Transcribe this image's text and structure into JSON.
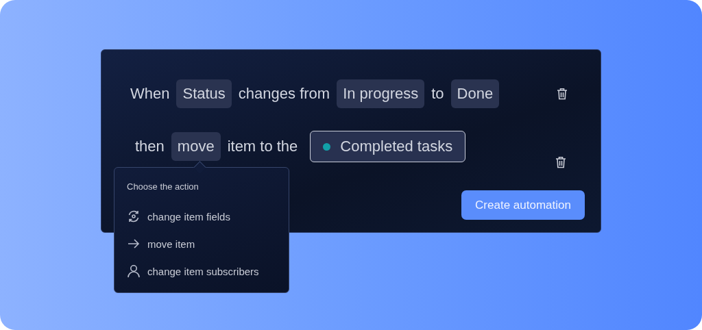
{
  "rules": [
    {
      "parts": [
        {
          "kind": "text",
          "text": "When"
        },
        {
          "kind": "chip",
          "text": "Status"
        },
        {
          "kind": "text",
          "text": "changes from"
        },
        {
          "kind": "chip",
          "text": "In progress"
        },
        {
          "kind": "text",
          "text": "to"
        },
        {
          "kind": "chip",
          "text": "Done"
        }
      ]
    },
    {
      "parts": [
        {
          "kind": "text",
          "text": "then"
        },
        {
          "kind": "chip",
          "text": "move"
        },
        {
          "kind": "text",
          "text": "item to the"
        },
        {
          "kind": "target",
          "text": "Completed tasks",
          "color": "#12a0a8"
        }
      ]
    }
  ],
  "create_button": "Create automation",
  "action_menu": {
    "title": "Choose the action",
    "items": [
      {
        "kind": "fields",
        "label": "change item fields"
      },
      {
        "kind": "move",
        "label": "move item"
      },
      {
        "kind": "subscribers",
        "label": "change item subscribers"
      }
    ]
  }
}
